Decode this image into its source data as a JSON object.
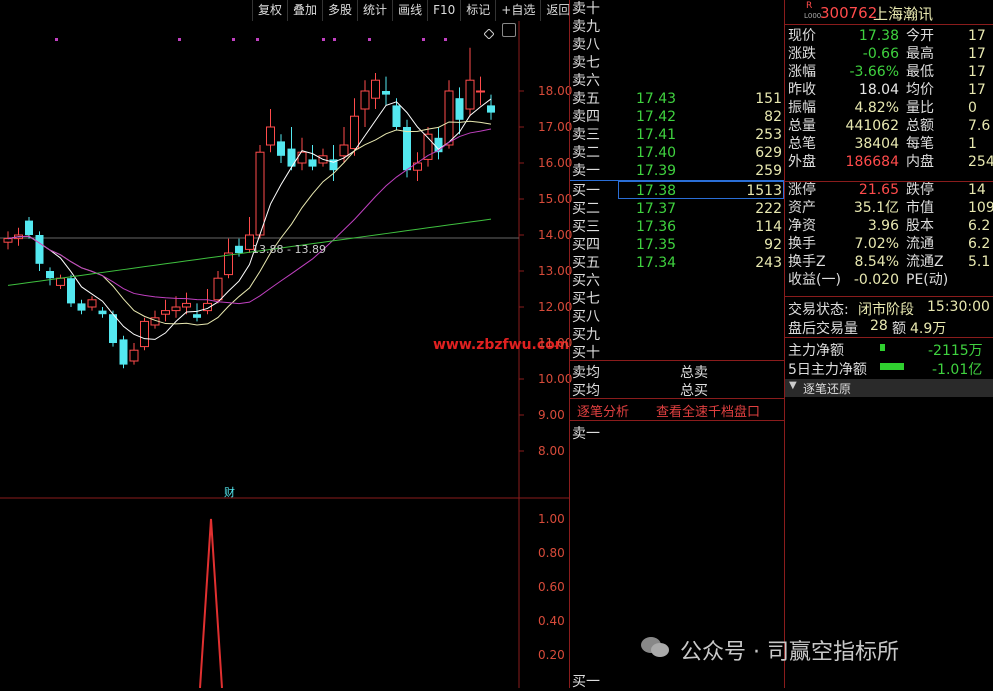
{
  "toolbar": {
    "items": [
      "复权",
      "叠加",
      "多股",
      "统计",
      "画线",
      "F10",
      "标记",
      "+自选",
      "返回"
    ]
  },
  "chart": {
    "price_axis": [
      "18.00",
      "17.00",
      "16.00",
      "15.00",
      "14.00",
      "13.00",
      "12.00",
      "11.00",
      "10.00",
      "9.00",
      "8.00"
    ],
    "ind_axis": [
      "1.00",
      "0.80",
      "0.60",
      "0.40",
      "0.20"
    ],
    "range_label": "13.88 - 13.89",
    "fin_marker": "财",
    "watermark": "www.zbzfwu.com"
  },
  "orderbook": {
    "sells": [
      {
        "label": "卖十",
        "price": "",
        "vol": ""
      },
      {
        "label": "卖九",
        "price": "",
        "vol": ""
      },
      {
        "label": "卖八",
        "price": "",
        "vol": ""
      },
      {
        "label": "卖七",
        "price": "",
        "vol": ""
      },
      {
        "label": "卖六",
        "price": "",
        "vol": ""
      },
      {
        "label": "卖五",
        "price": "17.43",
        "vol": "151"
      },
      {
        "label": "卖四",
        "price": "17.42",
        "vol": "82"
      },
      {
        "label": "卖三",
        "price": "17.41",
        "vol": "253"
      },
      {
        "label": "卖二",
        "price": "17.40",
        "vol": "629"
      },
      {
        "label": "卖一",
        "price": "17.39",
        "vol": "259"
      }
    ],
    "buys": [
      {
        "label": "买一",
        "price": "17.38",
        "vol": "1513"
      },
      {
        "label": "买二",
        "price": "17.37",
        "vol": "222"
      },
      {
        "label": "买三",
        "price": "17.36",
        "vol": "114"
      },
      {
        "label": "买四",
        "price": "17.35",
        "vol": "92"
      },
      {
        "label": "买五",
        "price": "17.34",
        "vol": "243"
      },
      {
        "label": "买六",
        "price": "",
        "vol": ""
      },
      {
        "label": "买七",
        "price": "",
        "vol": ""
      },
      {
        "label": "买八",
        "price": "",
        "vol": ""
      },
      {
        "label": "买九",
        "price": "",
        "vol": ""
      },
      {
        "label": "买十",
        "price": "",
        "vol": ""
      }
    ],
    "sell_avg": "卖均",
    "total_sell": "总卖",
    "buy_avg": "买均",
    "total_buy": "总买",
    "link_tick": "逐笔分析",
    "link_depth": "查看全速千档盘口",
    "tick_sell1": "卖一",
    "tick_buy1": "买一"
  },
  "quote": {
    "badge_r": "R",
    "badge_l": "L000",
    "code": "300762",
    "name": "上海瀚讯",
    "rows": [
      {
        "l": "现价",
        "v": "17.38",
        "c": "#3fd23f",
        "l2": "今开",
        "v2": "17"
      },
      {
        "l": "涨跌",
        "v": "-0.66",
        "c": "#3fd23f",
        "l2": "最高",
        "v2": "17"
      },
      {
        "l": "涨幅",
        "v": "-3.66%",
        "c": "#3fd23f",
        "l2": "最低",
        "v2": "17"
      },
      {
        "l": "昨收",
        "v": "18.04",
        "c": "#e8e8e8",
        "l2": "均价",
        "v2": "17"
      },
      {
        "l": "振幅",
        "v": "4.82%",
        "c": "#e8e8b0",
        "l2": "量比",
        "v2": "0"
      },
      {
        "l": "总量",
        "v": "441062",
        "c": "#e8e8b0",
        "l2": "总额",
        "v2": "7.6"
      },
      {
        "l": "总笔",
        "v": "38404",
        "c": "#e8e8b0",
        "l2": "每笔",
        "v2": "1"
      },
      {
        "l": "外盘",
        "v": "186684",
        "c": "#ff4b4b",
        "l2": "内盘",
        "v2": "254"
      },
      {
        "l": "涨停",
        "v": "21.65",
        "c": "#ff4b4b",
        "l2": "跌停",
        "v2": "14"
      },
      {
        "l": "资产",
        "v": "35.1亿",
        "c": "#e8e8b0",
        "l2": "市值",
        "v2": "109."
      },
      {
        "l": "净资",
        "v": "3.96",
        "c": "#e8e8b0",
        "l2": "股本",
        "v2": "6.2"
      },
      {
        "l": "换手",
        "v": "7.02%",
        "c": "#e8e8b0",
        "l2": "流通",
        "v2": "6.2"
      },
      {
        "l": "换手Z",
        "v": "8.54%",
        "c": "#e8e8b0",
        "l2": "流通Z",
        "v2": "5.1"
      },
      {
        "l": "收益(一)",
        "v": "-0.020",
        "c": "#e8e8b0",
        "l2": "PE(动)",
        "v2": ""
      }
    ],
    "status_label": "交易状态:",
    "status_value": "闭市阶段",
    "status_time": "15:30:00",
    "after_label": "盘后交易量",
    "after_vol": "28",
    "after_amt_label": "额",
    "after_amt": "4.9万",
    "main_net_label": "主力净额",
    "main_net": "-2115万",
    "main_5d_label": "5日主力净额",
    "main_5d": "-1.01亿",
    "restore": "逐笔还原"
  },
  "wechat": {
    "text": "公众号 · 司赢空指标所"
  },
  "colors": {
    "up": "#ff4b4b",
    "down": "#3fd23f",
    "cyan": "#54e8f0",
    "axis": "#8a1c1c"
  }
}
